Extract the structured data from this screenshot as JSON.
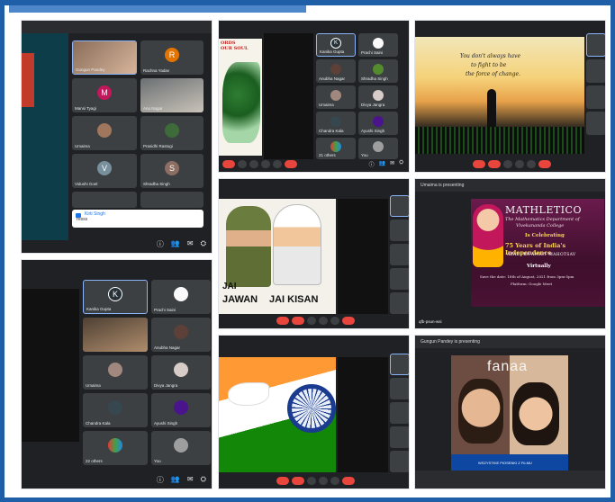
{
  "panel1": {
    "tiles": [
      {
        "name": "Gungun Pandey"
      },
      {
        "name": "Rachna Yadav",
        "initial": "R"
      },
      {
        "name": "Mansi Tyagi",
        "initial": "M"
      },
      {
        "name": "Anu Nagar"
      },
      {
        "name": "Umaima"
      },
      {
        "name": "Prasidhi Rastogi"
      },
      {
        "name": "Vidushi Goel",
        "initial": "V"
      },
      {
        "name": "Shradha Singh",
        "initial": "S"
      }
    ],
    "chat_sender": "Kirti Singh",
    "chat_message": "Yesss"
  },
  "panel2": {
    "poster_text": "ORDS\nOUR SOUL",
    "tiles": [
      {
        "name": "Kanika Gupta",
        "initial": "K"
      },
      {
        "name": "Prachi Saini"
      },
      {
        "name": "Anubha Nagar"
      },
      {
        "name": "Shradha Singh"
      },
      {
        "name": "Umaima"
      },
      {
        "name": "Divya Jangra"
      },
      {
        "name": "Chandra Kala"
      },
      {
        "name": "Ayushi Singh"
      },
      {
        "name": "21 others"
      },
      {
        "name": "You"
      }
    ]
  },
  "panel3": {
    "quote_line1": "You don't always have",
    "quote_line2": "to fight to be",
    "quote_line3": "the force of change."
  },
  "panel4": {
    "slogan1": "JAI",
    "slogan2": "JAWAN",
    "slogan3": "JAI KISAN"
  },
  "panel5": {
    "topbar": "Umaima is presenting",
    "poster_title": "MATHLETICO",
    "poster_sub1": "The Mathematics Department of",
    "poster_sub2": "Vivekananda College",
    "poster_celebrating": "Is Celebrating",
    "poster_years": "75 Years of India's Independence",
    "poster_azadi": "AZADI KA AMRIT MAHOTSAV",
    "poster_virtually": "Virtually",
    "poster_date": "Save the date: 18th of August, 2021 from 3pm-5pm",
    "poster_platform": "Platform: Google Meet",
    "bottom_code": "qfb-psun-wsi"
  },
  "panel6": {
    "hint": ""
  },
  "panel7": {
    "tiles": [
      {
        "name": "Kanika Gupta",
        "initial": "K"
      },
      {
        "name": "Prachi Saini"
      },
      {
        "name": "Anubha Nagar"
      },
      {
        "name": "Umaima"
      },
      {
        "name": "Divya Jangra"
      },
      {
        "name": "Chandra Kala"
      },
      {
        "name": "Ayushi Singh"
      },
      {
        "name": "22 others"
      },
      {
        "name": "You"
      }
    ]
  },
  "panel8": {
    "topbar": "Gungun Pandey is presenting",
    "movie_title": "fanaa",
    "poster_foot": "WSZYSTKIE PIOSENKI Z FILMU"
  }
}
